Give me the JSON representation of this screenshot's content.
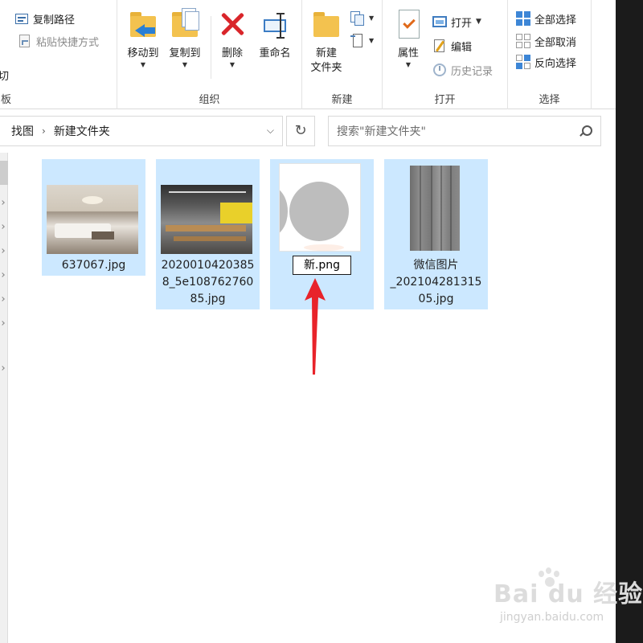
{
  "ribbon": {
    "clipboard": {
      "label": "板",
      "cut_label": "切",
      "copy_path_label": "复制路径",
      "paste_shortcut_label": "粘贴快捷方式"
    },
    "organize": {
      "label": "组织",
      "move_to_label": "移动到",
      "copy_to_label": "复制到",
      "delete_label": "删除",
      "rename_label": "重命名"
    },
    "new": {
      "label": "新建",
      "new_folder_line1": "新建",
      "new_folder_line2": "文件夹"
    },
    "open": {
      "label": "打开",
      "properties_label": "属性",
      "open_label": "打开",
      "edit_label": "编辑",
      "history_label": "历史记录"
    },
    "select": {
      "label": "选择",
      "select_all_label": "全部选择",
      "select_none_label": "全部取消",
      "invert_selection_label": "反向选择"
    }
  },
  "address": {
    "crumbs": [
      "找图",
      "新建文件夹"
    ],
    "search_placeholder": "搜索\"新建文件夹\""
  },
  "files": [
    {
      "name_lines": [
        "637067.jpg"
      ],
      "selected": true
    },
    {
      "name_lines": [
        "2020010420385",
        "8_5e108762760",
        "85.jpg"
      ],
      "selected": true
    },
    {
      "rename_value": "新.png",
      "selected": true,
      "renaming": true
    },
    {
      "name_lines": [
        "微信图片",
        "_202104281315",
        "05.jpg"
      ],
      "selected": true
    }
  ],
  "annotation": {
    "arrow_color": "#e8232a"
  },
  "colors": {
    "selection": "#cce8ff",
    "folder": "#f3c24f",
    "delete_red": "#d9252a",
    "accent_blue": "#2a7fd4"
  },
  "watermark": {
    "main": "Bai du 经验",
    "sub": "jingyan.baidu.com"
  }
}
